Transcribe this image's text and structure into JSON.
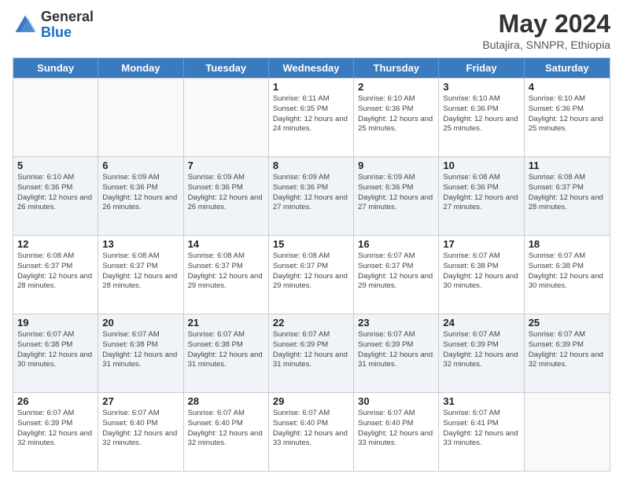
{
  "logo": {
    "general": "General",
    "blue": "Blue"
  },
  "title": "May 2024",
  "subtitle": "Butajira, SNNPR, Ethiopia",
  "header_days": [
    "Sunday",
    "Monday",
    "Tuesday",
    "Wednesday",
    "Thursday",
    "Friday",
    "Saturday"
  ],
  "weeks": [
    [
      {
        "day": "",
        "info": ""
      },
      {
        "day": "",
        "info": ""
      },
      {
        "day": "",
        "info": ""
      },
      {
        "day": "1",
        "info": "Sunrise: 6:11 AM\nSunset: 6:35 PM\nDaylight: 12 hours and 24 minutes."
      },
      {
        "day": "2",
        "info": "Sunrise: 6:10 AM\nSunset: 6:36 PM\nDaylight: 12 hours and 25 minutes."
      },
      {
        "day": "3",
        "info": "Sunrise: 6:10 AM\nSunset: 6:36 PM\nDaylight: 12 hours and 25 minutes."
      },
      {
        "day": "4",
        "info": "Sunrise: 6:10 AM\nSunset: 6:36 PM\nDaylight: 12 hours and 25 minutes."
      }
    ],
    [
      {
        "day": "5",
        "info": "Sunrise: 6:10 AM\nSunset: 6:36 PM\nDaylight: 12 hours and 26 minutes."
      },
      {
        "day": "6",
        "info": "Sunrise: 6:09 AM\nSunset: 6:36 PM\nDaylight: 12 hours and 26 minutes."
      },
      {
        "day": "7",
        "info": "Sunrise: 6:09 AM\nSunset: 6:36 PM\nDaylight: 12 hours and 26 minutes."
      },
      {
        "day": "8",
        "info": "Sunrise: 6:09 AM\nSunset: 6:36 PM\nDaylight: 12 hours and 27 minutes."
      },
      {
        "day": "9",
        "info": "Sunrise: 6:09 AM\nSunset: 6:36 PM\nDaylight: 12 hours and 27 minutes."
      },
      {
        "day": "10",
        "info": "Sunrise: 6:08 AM\nSunset: 6:36 PM\nDaylight: 12 hours and 27 minutes."
      },
      {
        "day": "11",
        "info": "Sunrise: 6:08 AM\nSunset: 6:37 PM\nDaylight: 12 hours and 28 minutes."
      }
    ],
    [
      {
        "day": "12",
        "info": "Sunrise: 6:08 AM\nSunset: 6:37 PM\nDaylight: 12 hours and 28 minutes."
      },
      {
        "day": "13",
        "info": "Sunrise: 6:08 AM\nSunset: 6:37 PM\nDaylight: 12 hours and 28 minutes."
      },
      {
        "day": "14",
        "info": "Sunrise: 6:08 AM\nSunset: 6:37 PM\nDaylight: 12 hours and 29 minutes."
      },
      {
        "day": "15",
        "info": "Sunrise: 6:08 AM\nSunset: 6:37 PM\nDaylight: 12 hours and 29 minutes."
      },
      {
        "day": "16",
        "info": "Sunrise: 6:07 AM\nSunset: 6:37 PM\nDaylight: 12 hours and 29 minutes."
      },
      {
        "day": "17",
        "info": "Sunrise: 6:07 AM\nSunset: 6:38 PM\nDaylight: 12 hours and 30 minutes."
      },
      {
        "day": "18",
        "info": "Sunrise: 6:07 AM\nSunset: 6:38 PM\nDaylight: 12 hours and 30 minutes."
      }
    ],
    [
      {
        "day": "19",
        "info": "Sunrise: 6:07 AM\nSunset: 6:38 PM\nDaylight: 12 hours and 30 minutes."
      },
      {
        "day": "20",
        "info": "Sunrise: 6:07 AM\nSunset: 6:38 PM\nDaylight: 12 hours and 31 minutes."
      },
      {
        "day": "21",
        "info": "Sunrise: 6:07 AM\nSunset: 6:38 PM\nDaylight: 12 hours and 31 minutes."
      },
      {
        "day": "22",
        "info": "Sunrise: 6:07 AM\nSunset: 6:39 PM\nDaylight: 12 hours and 31 minutes."
      },
      {
        "day": "23",
        "info": "Sunrise: 6:07 AM\nSunset: 6:39 PM\nDaylight: 12 hours and 31 minutes."
      },
      {
        "day": "24",
        "info": "Sunrise: 6:07 AM\nSunset: 6:39 PM\nDaylight: 12 hours and 32 minutes."
      },
      {
        "day": "25",
        "info": "Sunrise: 6:07 AM\nSunset: 6:39 PM\nDaylight: 12 hours and 32 minutes."
      }
    ],
    [
      {
        "day": "26",
        "info": "Sunrise: 6:07 AM\nSunset: 6:39 PM\nDaylight: 12 hours and 32 minutes."
      },
      {
        "day": "27",
        "info": "Sunrise: 6:07 AM\nSunset: 6:40 PM\nDaylight: 12 hours and 32 minutes."
      },
      {
        "day": "28",
        "info": "Sunrise: 6:07 AM\nSunset: 6:40 PM\nDaylight: 12 hours and 32 minutes."
      },
      {
        "day": "29",
        "info": "Sunrise: 6:07 AM\nSunset: 6:40 PM\nDaylight: 12 hours and 33 minutes."
      },
      {
        "day": "30",
        "info": "Sunrise: 6:07 AM\nSunset: 6:40 PM\nDaylight: 12 hours and 33 minutes."
      },
      {
        "day": "31",
        "info": "Sunrise: 6:07 AM\nSunset: 6:41 PM\nDaylight: 12 hours and 33 minutes."
      },
      {
        "day": "",
        "info": ""
      }
    ]
  ]
}
